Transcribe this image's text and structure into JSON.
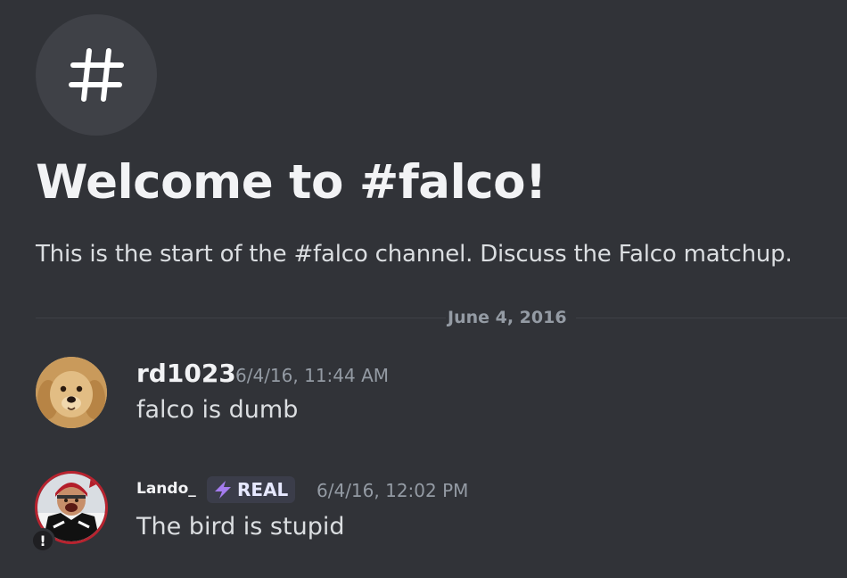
{
  "channel": {
    "icon": "hashtag-icon",
    "welcome_title": "Welcome to #falco!",
    "welcome_subtitle": "This is the start of the #falco channel. Discuss the Falco matchup."
  },
  "date_divider": "June 4, 2016",
  "messages": [
    {
      "username": "rd1023",
      "timestamp": "6/4/16, 11:44 AM",
      "content": "falco is dumb",
      "avatar": "golden-retriever-avatar"
    },
    {
      "username": "Lando_",
      "tag": {
        "icon": "lightning-icon",
        "label": "REAL"
      },
      "timestamp": "6/4/16, 12:02 PM",
      "content": "The bird is stupid",
      "avatar": "football-player-avatar",
      "status_badge": "!"
    }
  ],
  "colors": {
    "background": "#313338",
    "text_primary": "#f2f3f5",
    "text_muted": "#949ba4",
    "tag_icon": "#a57cf0"
  }
}
